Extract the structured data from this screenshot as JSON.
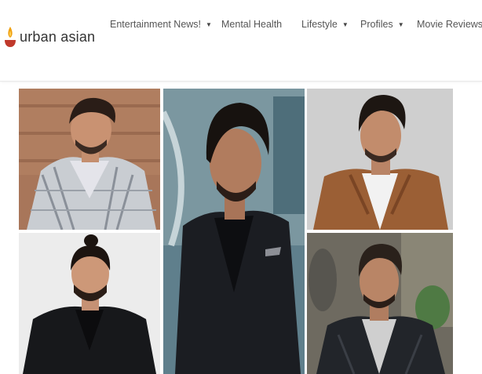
{
  "site": {
    "logo_text": "urban asian",
    "logo_icon": "diya-lamp-icon",
    "brand_colors": {
      "flame": "#f0a010",
      "bowl": "#c0392b"
    }
  },
  "nav": {
    "items": [
      {
        "label": "Entertainment News!",
        "has_dropdown": true
      },
      {
        "label": "Mental Health",
        "has_dropdown": false
      },
      {
        "label": "Lifestyle",
        "has_dropdown": true
      },
      {
        "label": "Profiles",
        "has_dropdown": true
      },
      {
        "label": "Movie Reviews",
        "has_dropdown": false
      }
    ],
    "dropdown_icon": "caret-down-icon"
  },
  "collage": {
    "photos": [
      {
        "id": "photo-top-left",
        "subject": "man in plaid blazer"
      },
      {
        "id": "photo-center",
        "subject": "man in black suit"
      },
      {
        "id": "photo-top-right",
        "subject": "man in brown suede jacket"
      },
      {
        "id": "photo-bottom-left",
        "subject": "man with topknot in black blazer"
      },
      {
        "id": "photo-bottom-right",
        "subject": "man in leather jacket"
      }
    ]
  }
}
